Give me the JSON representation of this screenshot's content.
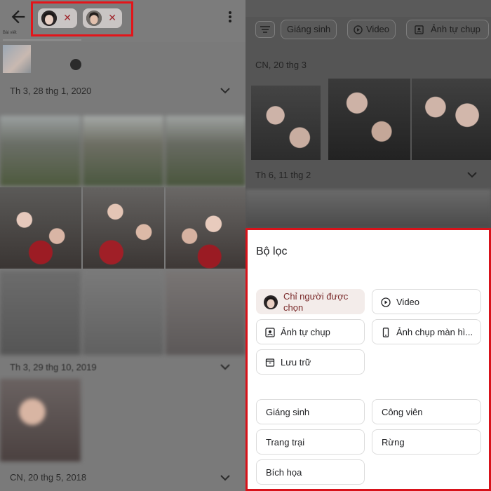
{
  "left": {
    "header_label": "Bài viết",
    "dates": [
      "Th 3, 28 thg 1, 2020",
      "Th 3, 29 thg 10, 2019",
      "CN, 20 thg 5, 2018"
    ]
  },
  "right": {
    "filter_chips": [
      "Giáng sinh",
      "Video",
      "Ảnh tự chụp"
    ],
    "dates": [
      "CN, 20 thg 3",
      "Th 6, 11 thg 2"
    ],
    "sheet": {
      "title": "Bộ lọc",
      "options": [
        {
          "label": "Chỉ người được",
          "label2": "chọn",
          "selected": true
        },
        {
          "label": "Video"
        },
        {
          "label": "Ảnh tự chụp"
        },
        {
          "label": "Ảnh chụp màn hì..."
        },
        {
          "label": "Lưu trữ"
        }
      ],
      "places": [
        "Giáng sinh",
        "Công viên",
        "Trang trại",
        "Rừng",
        "Bích họa"
      ]
    }
  },
  "colors": {
    "highlight_border": "#e3151a",
    "selected_chip": "#f3ecea",
    "chip_x": "#a0262c"
  }
}
